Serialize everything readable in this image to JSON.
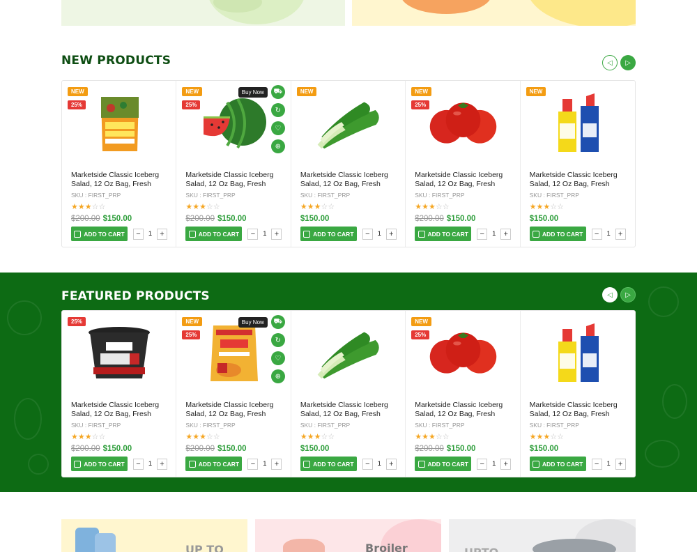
{
  "sections": {
    "new_title": "NEW PRODUCTS",
    "featured_title": "FEATURED PRODUCTS"
  },
  "colors": {
    "brand_green": "#3aa842",
    "dark_green": "#0d4d12",
    "band_green": "#0d6b14",
    "new_badge": "#f39c12",
    "sale_badge": "#e53935"
  },
  "labels": {
    "add_to_cart": "ADD TO CART",
    "buy_now": "Buy Now",
    "product_title": "Marketside Classic Iceberg Salad, 12 Oz Bag, Fresh",
    "sku": "SKU : FIRST_PRP",
    "old_price": "$200.00",
    "new_price": "$150.00",
    "qty": "1",
    "new_badge": "NEW",
    "sale_badge": "25%",
    "minus": "−",
    "plus": "+"
  },
  "new_products": [
    {
      "image": "veggie-pops-bag",
      "new": true,
      "sale": true,
      "old_price": true,
      "rating": 3
    },
    {
      "image": "watermelon",
      "new": true,
      "sale": true,
      "old_price": true,
      "rating": 3,
      "hover": true
    },
    {
      "image": "bok-choy",
      "new": true,
      "sale": false,
      "old_price": false,
      "rating": 3
    },
    {
      "image": "tomatoes",
      "new": true,
      "sale": true,
      "old_price": true,
      "rating": 3
    },
    {
      "image": "cleaner-bottles",
      "new": true,
      "sale": false,
      "old_price": false,
      "rating": 3
    }
  ],
  "featured_products": [
    {
      "image": "muffin-cup",
      "new": false,
      "sale": true,
      "old_price": true,
      "rating": 3
    },
    {
      "image": "spice-packet",
      "new": true,
      "sale": true,
      "old_price": true,
      "rating": 3,
      "hover": true
    },
    {
      "image": "bok-choy",
      "new": false,
      "sale": false,
      "old_price": false,
      "rating": 3
    },
    {
      "image": "tomatoes",
      "new": true,
      "sale": true,
      "old_price": true,
      "rating": 3
    },
    {
      "image": "cleaner-bottles",
      "new": false,
      "sale": false,
      "old_price": false,
      "rating": 3
    }
  ],
  "bottom_banners": {
    "left_text": "UP TO",
    "mid_text": "Broiler",
    "right_text": "UPTO"
  }
}
